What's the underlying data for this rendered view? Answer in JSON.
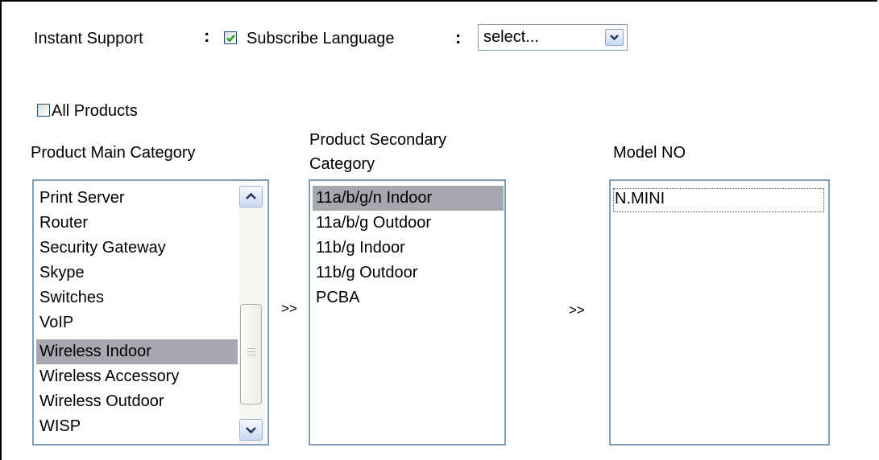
{
  "form": {
    "instant_support_label": "Instant Support",
    "colon": ":",
    "subscribe_language_label": "Subscribe Language",
    "language_select_value": "select...",
    "instant_support_checked": true,
    "all_products_label": "All Products",
    "all_products_checked": false
  },
  "columns": {
    "main_category_header": "Product Main Category",
    "secondary_category_header_line1": "Product Secondary",
    "secondary_category_header_line2": "Category",
    "model_header": "Model NO",
    "arrow_1": ">>",
    "arrow_2": ">>"
  },
  "main_category": {
    "options": [
      "Print Server",
      "Router",
      "Security Gateway",
      "Skype",
      "Switches",
      "VoIP",
      "Wireless Indoor",
      "Wireless Accessory",
      "Wireless Outdoor",
      "WISP"
    ],
    "selected": "Wireless Indoor"
  },
  "secondary_category": {
    "options": [
      "11a/b/g/n Indoor",
      "11a/b/g Outdoor",
      "11b/g Indoor",
      "11b/g Outdoor",
      "PCBA"
    ],
    "selected": "11a/b/g/n Indoor"
  },
  "models": {
    "options": [
      "N.MINI"
    ],
    "focused": "N.MINI"
  },
  "colors": {
    "selection_bg": "#a7a7b0",
    "border": "#7f9db9",
    "checkmark": "#21a121"
  }
}
